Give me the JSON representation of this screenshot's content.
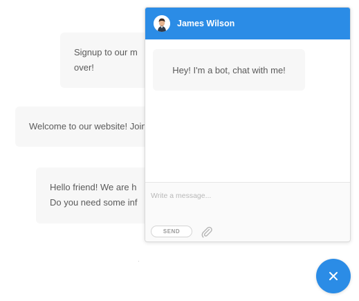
{
  "background_messages": [
    {
      "lines": [
        "Signup to our m",
        "over!"
      ]
    },
    {
      "lines": [
        "Welcome to our website! Join us now!"
      ]
    },
    {
      "lines": [
        "Hello friend! We are h",
        "Do you need some inf"
      ]
    }
  ],
  "chat": {
    "agent_name": "James Wilson",
    "avatar_icon": "user-avatar-icon",
    "messages": [
      {
        "text": "Hey! I'm a bot, chat with me!"
      }
    ],
    "input_placeholder": "Write a message...",
    "send_label": "SEND",
    "attach_icon": "paperclip-icon"
  },
  "launcher": {
    "icon": "close-icon"
  },
  "colors": {
    "accent": "#2b8ce6",
    "bubble": "#f7f7f7",
    "text": "#5a5a5a"
  }
}
